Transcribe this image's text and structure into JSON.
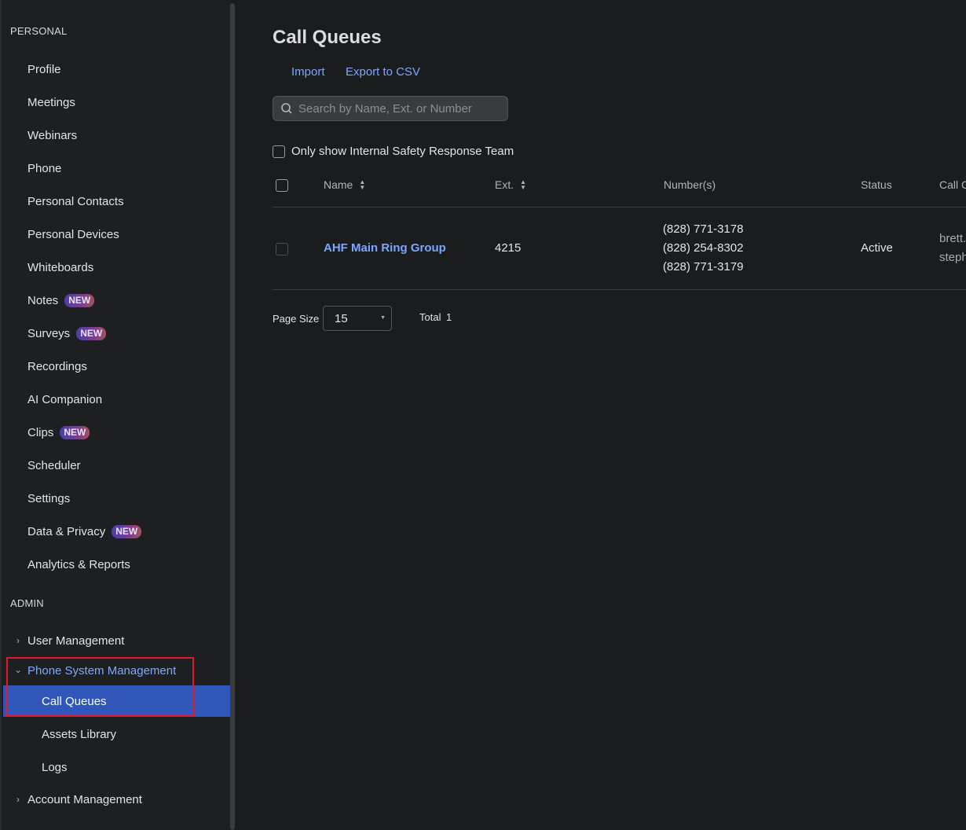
{
  "sidebar": {
    "personal_header": "PERSONAL",
    "personal_items": [
      {
        "label": "Profile"
      },
      {
        "label": "Meetings"
      },
      {
        "label": "Webinars"
      },
      {
        "label": "Phone"
      },
      {
        "label": "Personal Contacts"
      },
      {
        "label": "Personal Devices"
      },
      {
        "label": "Whiteboards"
      },
      {
        "label": "Notes",
        "badge": "NEW"
      },
      {
        "label": "Surveys",
        "badge": "NEW"
      },
      {
        "label": "Recordings"
      },
      {
        "label": "AI Companion"
      },
      {
        "label": "Clips",
        "badge": "NEW"
      },
      {
        "label": "Scheduler"
      },
      {
        "label": "Settings"
      },
      {
        "label": "Data & Privacy",
        "badge": "NEW"
      },
      {
        "label": "Analytics & Reports"
      }
    ],
    "admin_header": "ADMIN",
    "admin_items": {
      "user_management": "User Management",
      "phone_system_management": "Phone System Management",
      "call_queues": "Call Queues",
      "assets_library": "Assets Library",
      "logs": "Logs",
      "account_management": "Account Management"
    }
  },
  "main": {
    "title": "Call Queues",
    "toolbar": {
      "import_label": "Import",
      "export_label": "Export to CSV"
    },
    "search": {
      "placeholder": "Search by Name, Ext. or Number",
      "value": ""
    },
    "filter_label": "Only show Internal Safety Response Team",
    "table": {
      "headers": {
        "name": "Name",
        "ext": "Ext.",
        "numbers": "Number(s)",
        "status": "Status",
        "call": "Call C"
      },
      "rows": [
        {
          "name": "AHF Main Ring Group",
          "ext": "4215",
          "numbers": [
            "(828) 771-3178",
            "(828) 254-8302",
            "(828) 771-3179"
          ],
          "status": "Active",
          "members": [
            "brett.",
            "steph"
          ]
        }
      ]
    },
    "pagination": {
      "page_size_label": "Page Size",
      "page_size_value": "15",
      "total_label": "Total",
      "total_value": "1"
    }
  },
  "colors": {
    "accent": "#2f56b8",
    "link": "#7aa7ff",
    "highlight": "#e0192a",
    "background": "#1b1c1e"
  }
}
